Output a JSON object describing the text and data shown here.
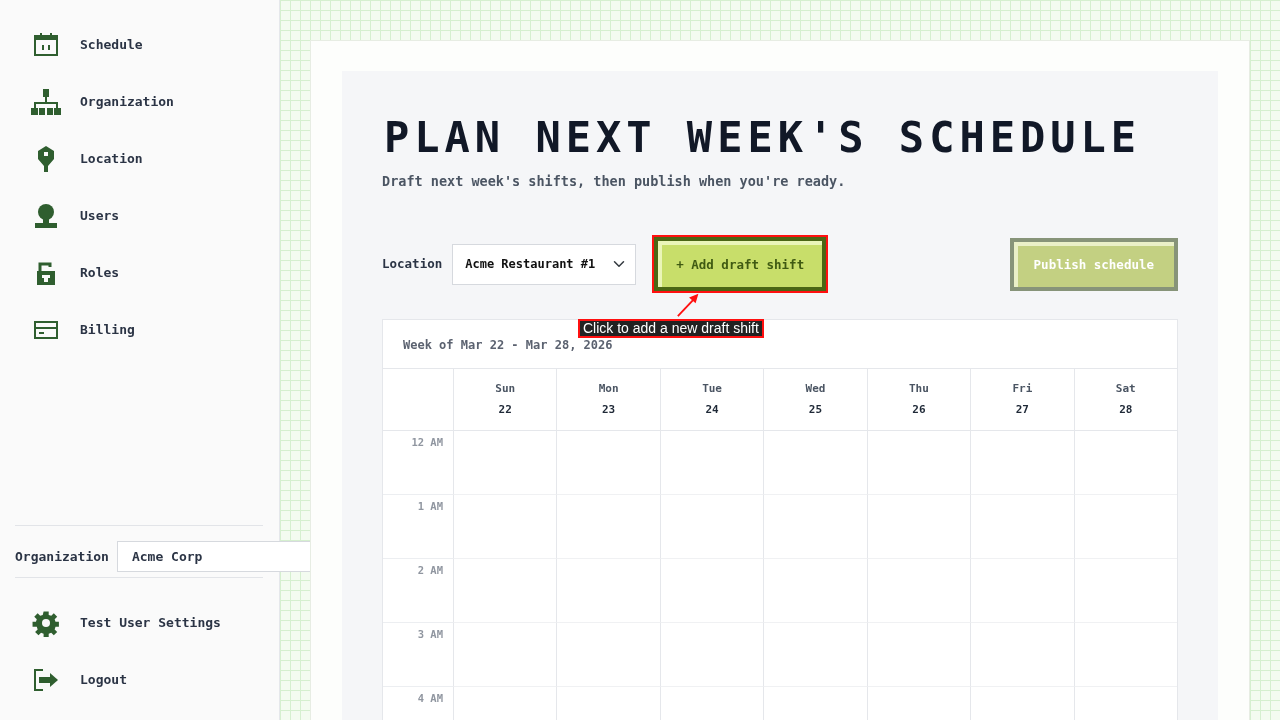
{
  "sidebar": {
    "nav_items": [
      {
        "label": "Schedule"
      },
      {
        "label": "Organization"
      },
      {
        "label": "Location"
      },
      {
        "label": "Users"
      },
      {
        "label": "Roles"
      },
      {
        "label": "Billing"
      }
    ],
    "organization": {
      "label": "Organization",
      "value": "Acme Corp"
    },
    "footer_items": [
      {
        "label": "Test User Settings"
      },
      {
        "label": "Logout"
      }
    ]
  },
  "page": {
    "title": "PLAN NEXT WEEK'S SCHEDULE",
    "subtitle": "Draft next week's shifts, then publish when you're ready."
  },
  "toolbar": {
    "location_label": "Location",
    "location_value": "Acme Restaurant #1",
    "add_button": {
      "label": "+ Add draft shift",
      "highlighted": true
    },
    "publish_button": {
      "label": "Publish schedule",
      "disabled": true
    }
  },
  "annotation": {
    "text": "Click to add a new draft shift"
  },
  "calendar": {
    "week_label": "Week of Mar 22 - Mar 28, 2026",
    "days": [
      {
        "name": "Sun",
        "date": "22"
      },
      {
        "name": "Mon",
        "date": "23"
      },
      {
        "name": "Tue",
        "date": "24"
      },
      {
        "name": "Wed",
        "date": "25"
      },
      {
        "name": "Thu",
        "date": "26"
      },
      {
        "name": "Fri",
        "date": "27"
      },
      {
        "name": "Sat",
        "date": "28"
      }
    ],
    "hours": [
      "12 AM",
      "1 AM",
      "2 AM",
      "3 AM",
      "4 AM"
    ]
  }
}
